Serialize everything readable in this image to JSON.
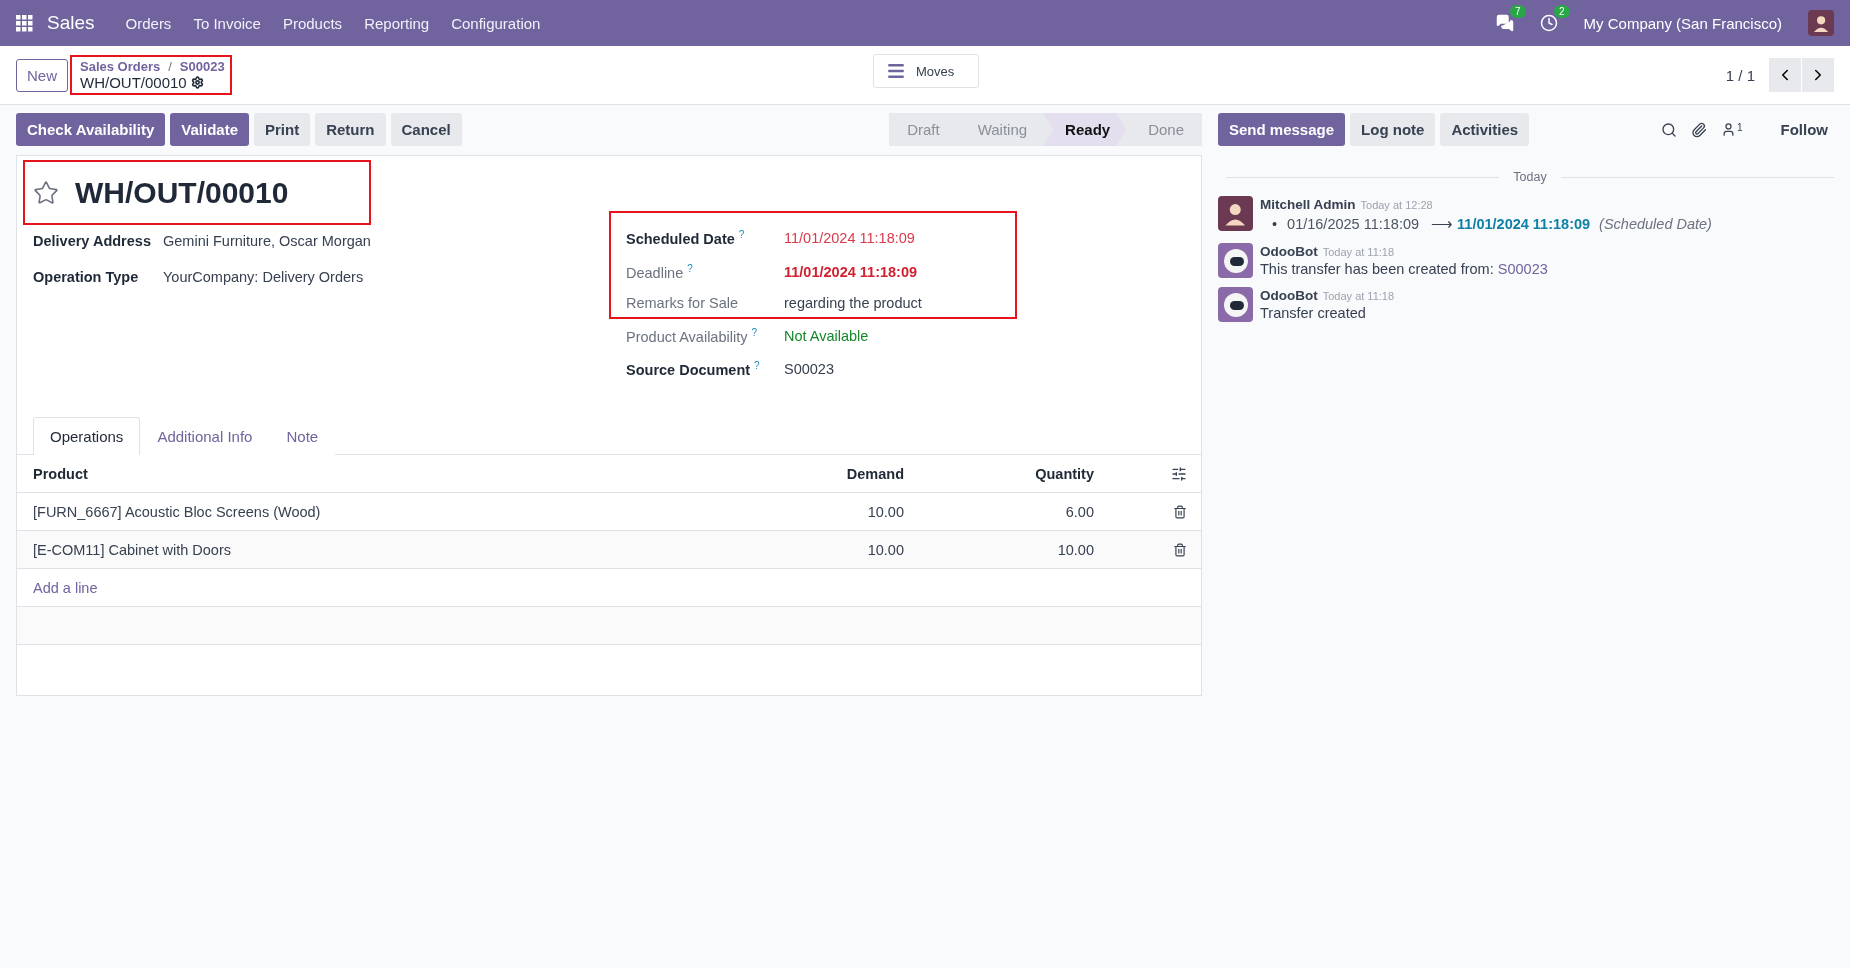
{
  "navbar": {
    "app": "Sales",
    "menu": [
      "Orders",
      "To Invoice",
      "Products",
      "Reporting",
      "Configuration"
    ],
    "messages_count": "7",
    "activities_count": "2",
    "company": "My Company (San Francisco)"
  },
  "control_panel": {
    "new_button": "New",
    "breadcrumb": {
      "highlighted": true,
      "items": [
        "Sales Orders",
        "S00023"
      ],
      "separator": "/",
      "record": "WH/OUT/00010"
    },
    "moves_button": "Moves",
    "pager": "1 / 1"
  },
  "actions": [
    {
      "label": "Check Availability",
      "primary": true
    },
    {
      "label": "Validate",
      "primary": true
    },
    {
      "label": "Print",
      "primary": false
    },
    {
      "label": "Return",
      "primary": false
    },
    {
      "label": "Cancel",
      "primary": false
    }
  ],
  "status": [
    {
      "label": "Draft",
      "selected": false
    },
    {
      "label": "Waiting",
      "selected": false
    },
    {
      "label": "Ready",
      "selected": true
    },
    {
      "label": "Done",
      "selected": false
    }
  ],
  "form": {
    "title": "WH/OUT/00010",
    "title_highlighted": true,
    "starred": false,
    "left_fields": [
      {
        "label": "Delivery Address",
        "value": "Gemini Furniture, Oscar Morgan"
      },
      {
        "label": "Operation Type",
        "value": "YourCompany: Delivery Orders"
      }
    ],
    "right_blocks": [
      {
        "highlighted": true,
        "fields": [
          {
            "label": "Scheduled Date",
            "muted_label": false,
            "help": "?",
            "value": "11/01/2024 11:18:09",
            "color": "#d9394c",
            "value_bold": false
          },
          {
            "label": "Deadline",
            "muted_label": true,
            "help": "?",
            "value": "11/01/2024 11:18:09",
            "color": "#d1202f",
            "value_bold": true
          },
          {
            "label": "Remarks for Sale",
            "muted_label": true,
            "value": "regarding the product",
            "color": "#374151",
            "value_bold": false
          }
        ]
      },
      {
        "highlighted": false,
        "fields": [
          {
            "label": "Product Availability",
            "muted_label": true,
            "help": "?",
            "value": "Not Available",
            "color": "#16872a",
            "value_bold": false
          },
          {
            "label": "Source Document",
            "muted_label": false,
            "help": "?",
            "value": "S00023",
            "color": "#374151",
            "value_bold": false
          }
        ]
      }
    ],
    "tabs": [
      {
        "label": "Operations",
        "selected": true
      },
      {
        "label": "Additional Info",
        "selected": false
      },
      {
        "label": "Note",
        "selected": false
      }
    ],
    "table": {
      "columns": [
        "Product",
        "Demand",
        "Quantity"
      ],
      "rows": [
        {
          "product": "[FURN_6667] Acoustic Bloc Screens (Wood)",
          "demand": "10.00",
          "quantity": "6.00"
        },
        {
          "product": "[E-COM11] Cabinet with Doors",
          "demand": "10.00",
          "quantity": "10.00"
        }
      ],
      "add_line": "Add a line"
    }
  },
  "chatter": {
    "buttons": [
      {
        "label": "Send message",
        "primary": true
      },
      {
        "label": "Log note",
        "primary": false
      },
      {
        "label": "Activities",
        "primary": false
      }
    ],
    "followers_count": "1",
    "follow": "Follow",
    "day": "Today",
    "messages": [
      {
        "author": "Mitchell Admin",
        "bot": false,
        "time": "Today at 12:28",
        "kind": "tracking",
        "bullet": "•",
        "old": "01/16/2025 11:18:09",
        "arrow": "⟶",
        "new": "11/01/2024 11:18:09",
        "field": "(Scheduled Date)"
      },
      {
        "author": "OdooBot",
        "bot": true,
        "time": "Today at 11:18",
        "kind": "text",
        "body": "This transfer has been created from:",
        "link": "S00023"
      },
      {
        "author": "OdooBot",
        "bot": true,
        "time": "Today at 11:18",
        "kind": "text",
        "body": "Transfer created"
      }
    ]
  }
}
